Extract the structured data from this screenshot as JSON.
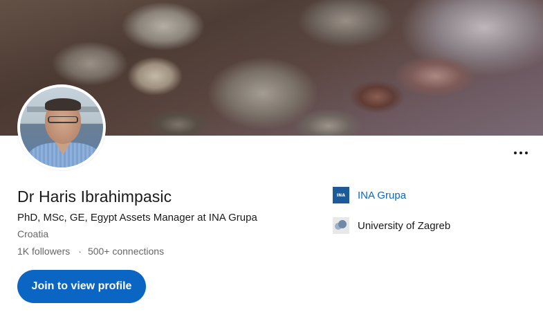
{
  "profile": {
    "name": "Dr Haris Ibrahimpasic",
    "headline": "PhD, MSc, GE, Egypt Assets Manager at INA Grupa",
    "location": "Croatia",
    "followers": "1K followers",
    "separator": "·",
    "connections": "500+ connections"
  },
  "actions": {
    "join_label": "Join to view profile",
    "more_icon": "more-horizontal-icon"
  },
  "organizations": {
    "company": {
      "name": "INA Grupa",
      "logo_text": "INA"
    },
    "school": {
      "name": "University of Zagreb"
    }
  },
  "colors": {
    "accent": "#0a66c2",
    "text_primary": "#191919",
    "text_secondary": "#666666"
  }
}
